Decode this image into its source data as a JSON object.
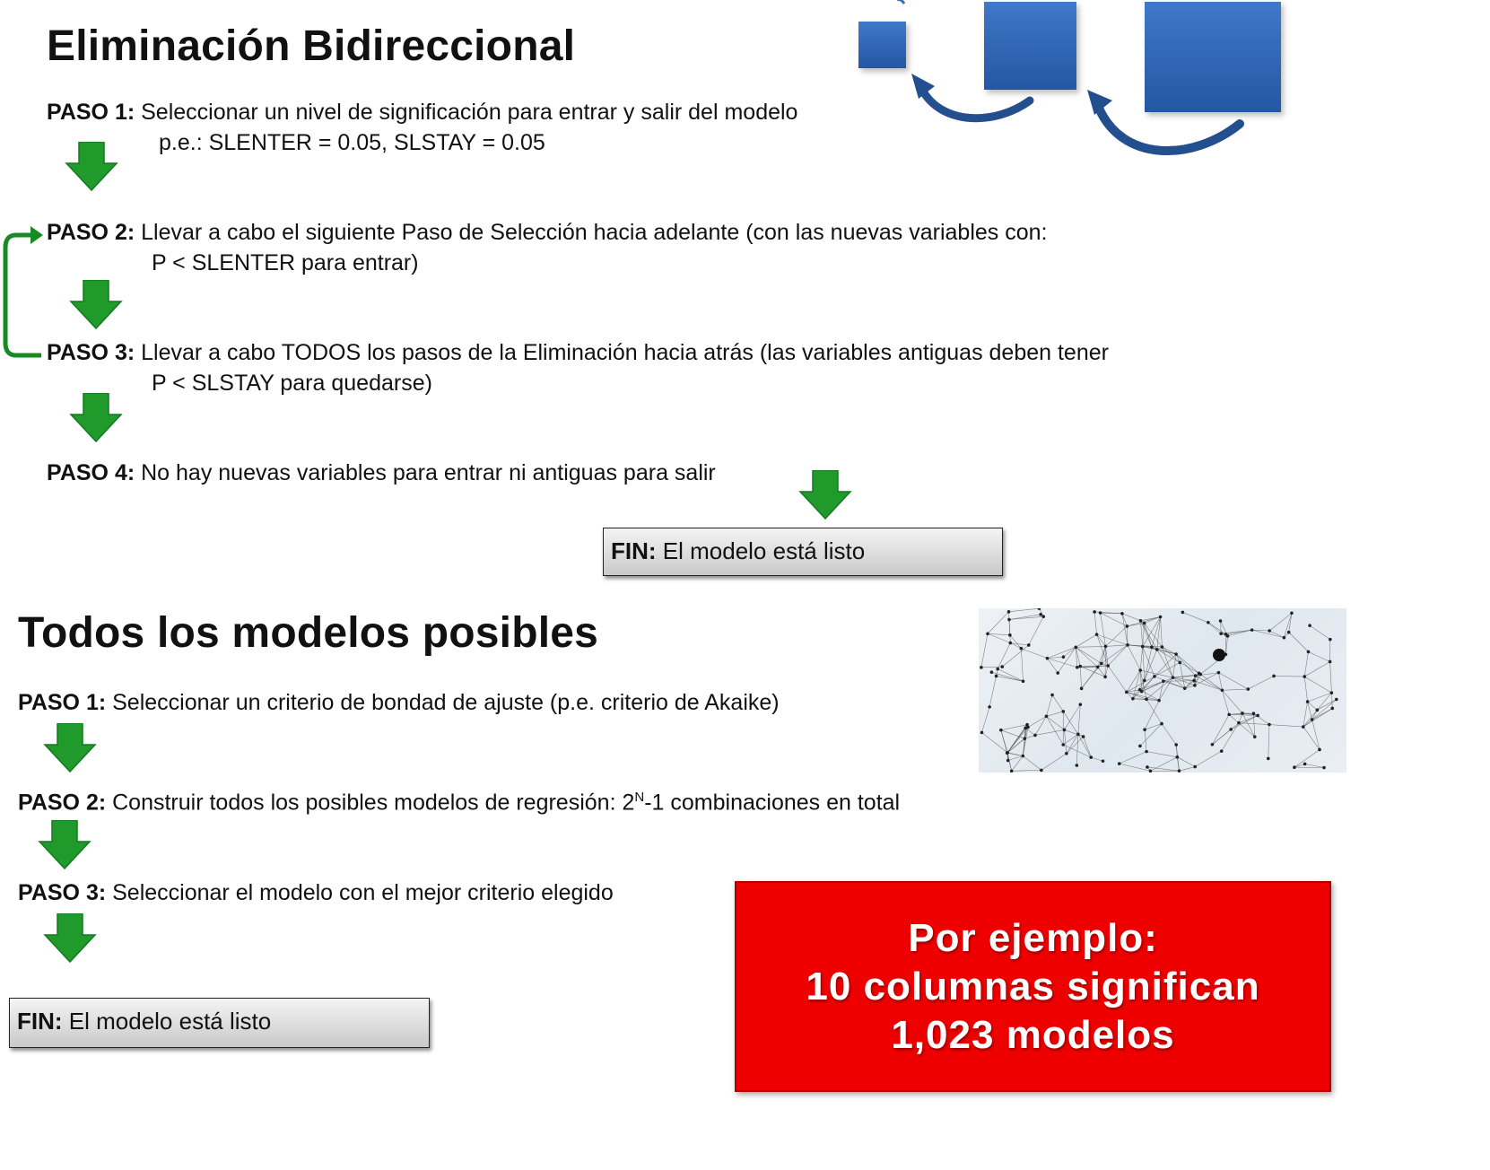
{
  "section1": {
    "title": "Eliminación Bidireccional",
    "steps": [
      {
        "label": "PASO 1:",
        "text": " Seleccionar un nivel de significación para entrar y salir del modelo",
        "sub": "p.e.: SLENTER = 0.05, SLSTAY = 0.05"
      },
      {
        "label": "PASO 2:",
        "text": " Llevar a cabo el siguiente Paso de Selección hacia adelante (con las nuevas variables con:",
        "sub": "P < SLENTER para entrar)"
      },
      {
        "label": "PASO 3:",
        "text": " Llevar a cabo TODOS los pasos de la Eliminación hacia atrás (las variables antiguas deben tener",
        "sub": "P < SLSTAY para quedarse)"
      },
      {
        "label": "PASO 4:",
        "text": " No hay nuevas variables para entrar ni antiguas para salir"
      }
    ],
    "fin": {
      "label": "FIN:",
      "text": " El modelo está listo"
    }
  },
  "section2": {
    "title": "Todos los modelos posibles",
    "steps": [
      {
        "label": "PASO 1:",
        "text": " Seleccionar un criterio de bondad de ajuste  (p.e. criterio de Akaike)"
      },
      {
        "label": "PASO 2:",
        "text_before": " Construir todos los posibles modelos de regresión: 2",
        "sup": "N",
        "text_after": "-1 combinaciones en total"
      },
      {
        "label": "PASO 3:",
        "text": " Seleccionar el modelo con el mejor criterio elegido"
      }
    ],
    "fin": {
      "label": "FIN:",
      "text": " El modelo está listo"
    },
    "callout": {
      "lines": [
        "Por ejemplo:",
        "10 columnas significan",
        "1,023 modelos"
      ]
    }
  },
  "colors": {
    "arrow_green": "#1f9a2b",
    "loop_green": "#178a24",
    "callout_red": "#ee0000",
    "square_blue": "#2f63b0",
    "curve_blue": "#244f8e"
  },
  "icons": {
    "step_arrow": "down-arrow-icon",
    "loop": "loop-arrow-icon",
    "decor": "blue-squares-graphic",
    "network": "network-graph-image"
  }
}
